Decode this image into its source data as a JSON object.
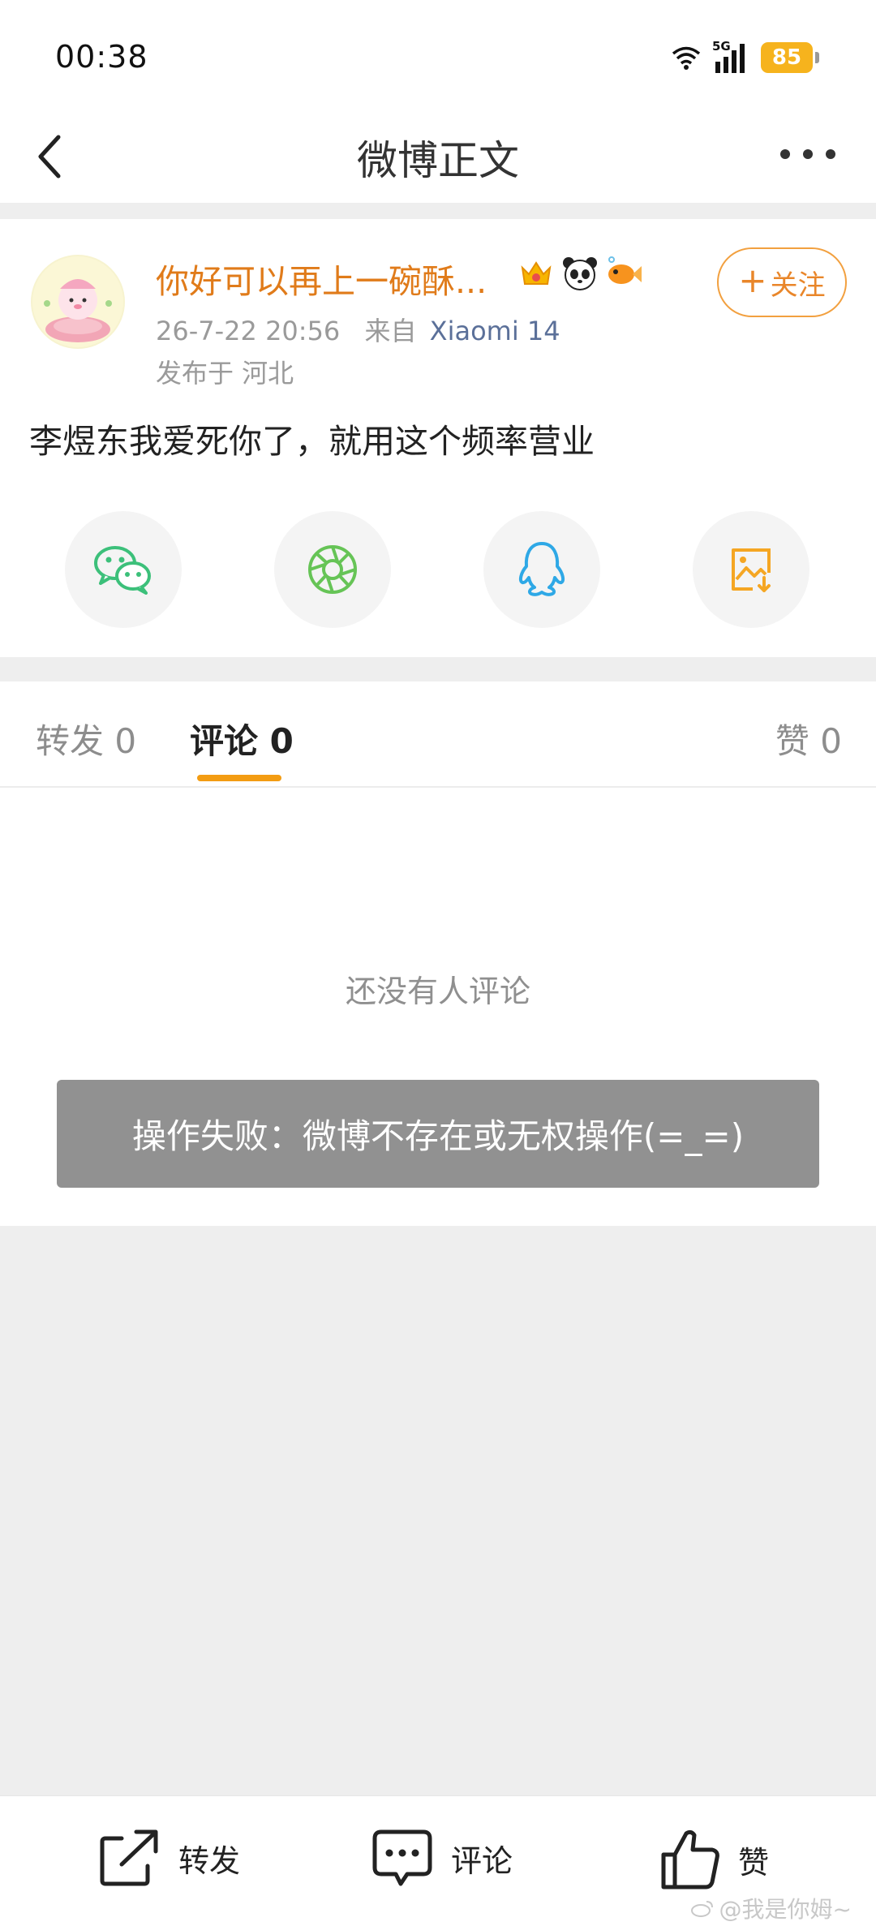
{
  "status_bar": {
    "time": "00:38",
    "network": "5G",
    "battery": "85",
    "icons": [
      "wifi-icon",
      "signal-icon",
      "battery-icon"
    ]
  },
  "header": {
    "title": "微博正文",
    "back_icon": "chevron-left-icon",
    "more_icon": "more-dots-icon"
  },
  "post": {
    "username": "你好可以再上一碗酥...",
    "badge_icons": [
      "crown-icon",
      "panda-icon",
      "goldfish-icon"
    ],
    "timestamp": "26-7-22 20:56",
    "source_prefix": "来自",
    "source_device": "Xiaomi 14",
    "location": "发布于 河北",
    "follow_label": "关注",
    "text": "李煜东我爱死你了，就用这个频率营业",
    "share_targets": [
      "wechat-icon",
      "moments-icon",
      "qq-icon",
      "save-image-icon"
    ]
  },
  "tabs": {
    "repost": "转发 0",
    "comment": "评论 0",
    "like": "赞 0",
    "active": "comment"
  },
  "comments": {
    "empty_text": "还没有人评论",
    "toast": "操作失败：微博不存在或无权操作(=_=)"
  },
  "toolbar": {
    "repost": "转发",
    "comment": "评论",
    "like": "赞"
  },
  "watermark": "@我是你姆~",
  "colors": {
    "accent": "#f39c12",
    "username": "#e07b1a",
    "link": "#5b7099",
    "battery": "#f6b31d"
  }
}
